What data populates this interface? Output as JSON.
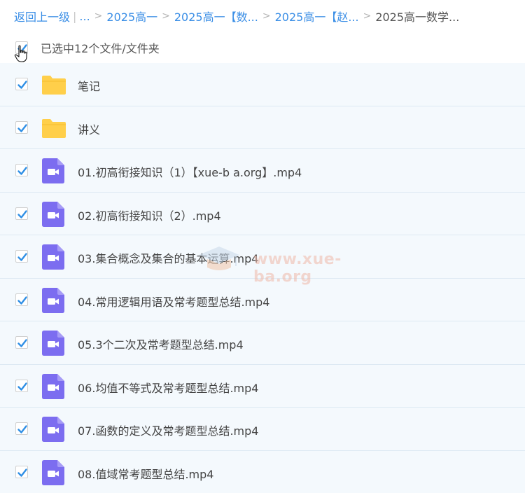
{
  "breadcrumb": {
    "back_label": "返回上一级",
    "ellipsis": "...",
    "crumbs": [
      "2025高一",
      "2025高一【数...",
      "2025高一【赵..."
    ],
    "current": "2025高一数学..."
  },
  "selection": {
    "summary": "已选中12个文件/文件夹",
    "checked": true
  },
  "files": [
    {
      "name": "笔记",
      "type": "folder",
      "checked": true
    },
    {
      "name": "讲义",
      "type": "folder",
      "checked": true
    },
    {
      "name": "01.初高衔接知识（1）【xue-b a.org】.mp4",
      "type": "video",
      "checked": true
    },
    {
      "name": "02.初高衔接知识（2）.mp4",
      "type": "video",
      "checked": true
    },
    {
      "name": "03.集合概念及集合的基本运算.mp4",
      "type": "video",
      "checked": true
    },
    {
      "name": "04.常用逻辑用语及常考题型总结.mp4",
      "type": "video",
      "checked": true
    },
    {
      "name": "05.3个二次及常考题型总结.mp4",
      "type": "video",
      "checked": true
    },
    {
      "name": "06.均值不等式及常考题型总结.mp4",
      "type": "video",
      "checked": true
    },
    {
      "name": "07.函数的定义及常考题型总结.mp4",
      "type": "video",
      "checked": true
    },
    {
      "name": "08.值域常考题型总结.mp4",
      "type": "video",
      "checked": true
    }
  ],
  "watermark": {
    "text": "www.xue-ba.org"
  },
  "colors": {
    "link": "#3a8ee6",
    "checkbox": "#2f8fe5",
    "folder": "#ffcf4a",
    "video": "#7c6df0",
    "row_bg": "#f4f9fd"
  }
}
